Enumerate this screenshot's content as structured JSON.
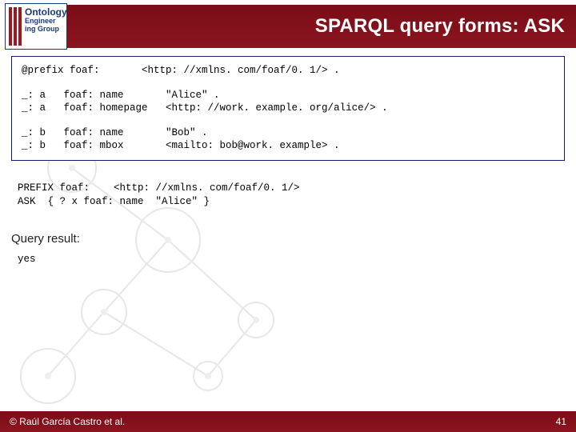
{
  "logo": {
    "line1": "Ontology",
    "line2": "Engineer",
    "line3": "ing Group"
  },
  "header": {
    "title": "SPARQL query forms: ASK"
  },
  "code_box": "@prefix foaf:       <http: //xmlns. com/foaf/0. 1/> .\n\n_: a   foaf: name       \"Alice\" .\n_: a   foaf: homepage   <http: //work. example. org/alice/> .\n\n_: b   foaf: name       \"Bob\" .\n_: b   foaf: mbox       <mailto: bob@work. example> .",
  "query_block": "PREFIX foaf:    <http: //xmlns. com/foaf/0. 1/>\nASK  { ? x foaf: name  \"Alice\" }",
  "result_label": "Query result:",
  "result_value": "yes",
  "footer": {
    "copyright": "© Raúl García Castro et al.",
    "page": "41"
  }
}
